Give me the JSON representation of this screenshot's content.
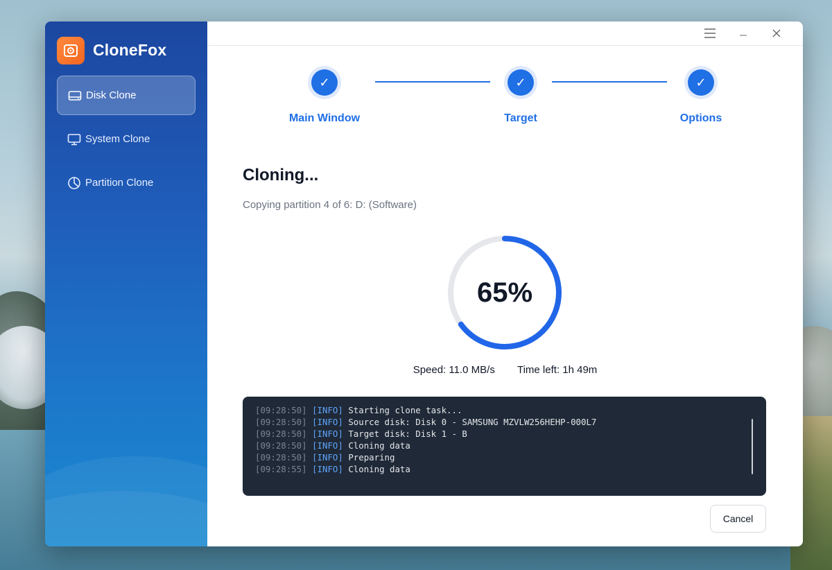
{
  "app": {
    "name": "CloneFox"
  },
  "sidebar": {
    "items": [
      {
        "label": "Disk Clone",
        "icon": "disk-icon",
        "active": true
      },
      {
        "label": "System Clone",
        "icon": "monitor-icon",
        "active": false
      },
      {
        "label": "Partition Clone",
        "icon": "pie-chart-icon",
        "active": false
      }
    ]
  },
  "titlebar": {
    "icons": [
      "menu-icon",
      "minimize-icon",
      "close-icon"
    ]
  },
  "steps": [
    {
      "label": "Main Window",
      "status": "done"
    },
    {
      "label": "Target",
      "status": "done"
    },
    {
      "label": "Options",
      "status": "done"
    }
  ],
  "clone": {
    "title": "Cloning...",
    "subtitle": "Copying partition 4 of 6: D: (Software)",
    "progress_percent": 65,
    "progress_label": "65%",
    "speed": "Speed: 11.0 MB/s",
    "time_left": "Time left: 1h 49m"
  },
  "log": [
    {
      "ts": "[09:28:50]",
      "level": "[INFO]",
      "msg": "Starting clone task..."
    },
    {
      "ts": "[09:28:50]",
      "level": "[INFO]",
      "msg": "Source disk: Disk 0 - SAMSUNG MZVLW256HEHP-000L7"
    },
    {
      "ts": "[09:28:50]",
      "level": "[INFO]",
      "msg": "Target disk: Disk 1 - B"
    },
    {
      "ts": "[09:28:50]",
      "level": "[INFO]",
      "msg": "Cloning data"
    },
    {
      "ts": "[09:28:50]",
      "level": "[INFO]",
      "msg": "Preparing"
    },
    {
      "ts": "[09:28:55]",
      "level": "[INFO]",
      "msg": "Cloning data"
    }
  ],
  "actions": {
    "cancel_label": "Cancel"
  },
  "colors": {
    "accent": "#1f6fe5",
    "sidebar_top": "#1c47a0",
    "sidebar_bottom": "#1a8ad1",
    "log_bg": "#1f2937"
  }
}
